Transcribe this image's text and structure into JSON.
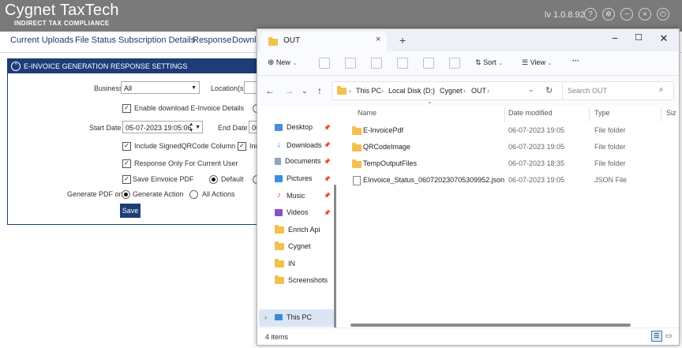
{
  "app": {
    "brand_name": "Cygnet TaxTech",
    "brand_tagline": "INDIRECT TAX COMPLIANCE",
    "version": "lv 1.0.8.92",
    "nav": [
      "Current Uploads",
      "File Status",
      "Subscription Details",
      "Response",
      "Downlo"
    ]
  },
  "panel": {
    "title": "E-INVOICE GENERATION RESPONSE SETTINGS",
    "business_label": "Business",
    "business_value": "All",
    "location_label": "Location(s)",
    "enable_download_label": "Enable download E-Invoice Details",
    "start_date_label": "Start Date",
    "start_date_value": "05-07-2023 19:05:06",
    "end_date_label": "End Date",
    "end_date_value": "06",
    "include_qr_label": "Include SignedQRCode Column",
    "include_other_label": "Inc",
    "response_only_label": "Response Only For Current User",
    "save_pdf_label": "Save Einvoice PDF",
    "default_label": "Default",
    "generate_pdf_label": "Generate PDF on :",
    "generate_action_label": "Generate Action",
    "all_actions_label": "All Actions",
    "save_label": "Save"
  },
  "explorer": {
    "tab_title": "OUT",
    "new_tab_symbol": "+",
    "toolbar": {
      "new": "New",
      "sort": "Sort",
      "view": "View",
      "more": "···"
    },
    "breadcrumbs": [
      "This PC",
      "Local Disk (D:)",
      "Cygnet",
      "OUT"
    ],
    "search_placeholder": "Search OUT",
    "nav_items": [
      {
        "label": "Desktop",
        "icon": "desktop-icon",
        "pinned": true
      },
      {
        "label": "Downloads",
        "icon": "download-icon",
        "pinned": true
      },
      {
        "label": "Documents",
        "icon": "document-icon",
        "pinned": true
      },
      {
        "label": "Pictures",
        "icon": "pictures-icon",
        "pinned": true
      },
      {
        "label": "Music",
        "icon": "music-icon",
        "pinned": true
      },
      {
        "label": "Videos",
        "icon": "videos-icon",
        "pinned": true
      },
      {
        "label": "Enrich Api",
        "icon": "folder-icon",
        "pinned": false
      },
      {
        "label": "Cygnet",
        "icon": "folder-icon",
        "pinned": false
      },
      {
        "label": "IN",
        "icon": "folder-icon",
        "pinned": false
      },
      {
        "label": "Screenshots",
        "icon": "folder-icon",
        "pinned": false
      }
    ],
    "this_pc_label": "This PC",
    "columns": [
      "Name",
      "Date modified",
      "Type",
      "Siz"
    ],
    "files": [
      {
        "name": "E-InvoicePdf",
        "date": "06-07-2023 19:05",
        "type": "File folder",
        "icon": "folder-icon"
      },
      {
        "name": "QRCodeImage",
        "date": "06-07-2023 19:05",
        "type": "File folder",
        "icon": "folder-icon"
      },
      {
        "name": "TempOutputFiles",
        "date": "06-07-2023 18:35",
        "type": "File folder",
        "icon": "folder-icon"
      },
      {
        "name": "EInvoice_Status_060720230705309952.json",
        "date": "06-07-2023 19:05",
        "type": "JSON File",
        "icon": "json-file-icon"
      }
    ],
    "status": "4 items"
  }
}
